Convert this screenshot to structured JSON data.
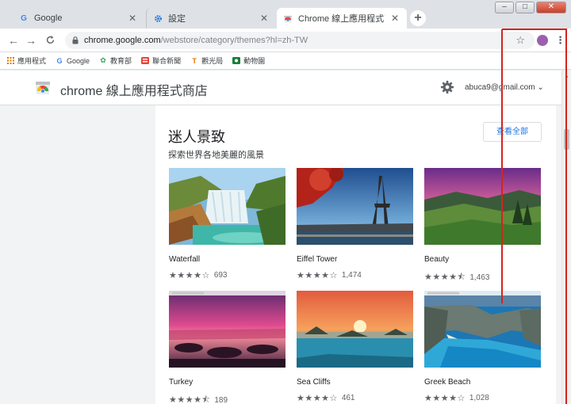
{
  "tabs": [
    {
      "title": "Google",
      "favicon": "google-g-icon"
    },
    {
      "title": "設定",
      "favicon": "settings-gear-icon"
    },
    {
      "title": "Chrome 線上應用程式商店 - 主題",
      "favicon": "webstore-icon"
    }
  ],
  "toolbar": {
    "url_host": "chrome.google.com",
    "url_path": "/webstore/category/themes?hl=zh-TW"
  },
  "bookmarks": [
    {
      "label": "應用程式",
      "icon": "apps-grid-icon",
      "color": "#e37400"
    },
    {
      "label": "Google",
      "icon": "google-g-icon",
      "color": "#4285f4"
    },
    {
      "label": "教育部",
      "icon": "moe-icon",
      "color": "#34a853"
    },
    {
      "label": "聯合新聞",
      "icon": "news-icon",
      "color": "#ea4335"
    },
    {
      "label": "觀光局",
      "icon": "tourism-icon",
      "color": "#e37400"
    },
    {
      "label": "動物園",
      "icon": "zoo-icon",
      "color": "#188038"
    }
  ],
  "store": {
    "title": "chrome 線上應用程式商店",
    "account": "abuca9@gmail.com"
  },
  "section": {
    "title": "迷人景致",
    "subtitle": "探索世界各地美麗的風景",
    "view_all": "查看全部"
  },
  "themes": [
    {
      "name": "Waterfall",
      "stars": "★★★★☆",
      "count": "693"
    },
    {
      "name": "Eiffel Tower",
      "stars": "★★★★☆",
      "count": "1,474"
    },
    {
      "name": "Beauty",
      "stars": "★★★★⯪",
      "count": "1,463"
    },
    {
      "name": "Turkey",
      "stars": "★★★★⯪",
      "count": "189"
    },
    {
      "name": "Sea Cliffs",
      "stars": "★★★★☆",
      "count": "461"
    },
    {
      "name": "Greek Beach",
      "stars": "★★★★☆",
      "count": "1,028"
    }
  ]
}
